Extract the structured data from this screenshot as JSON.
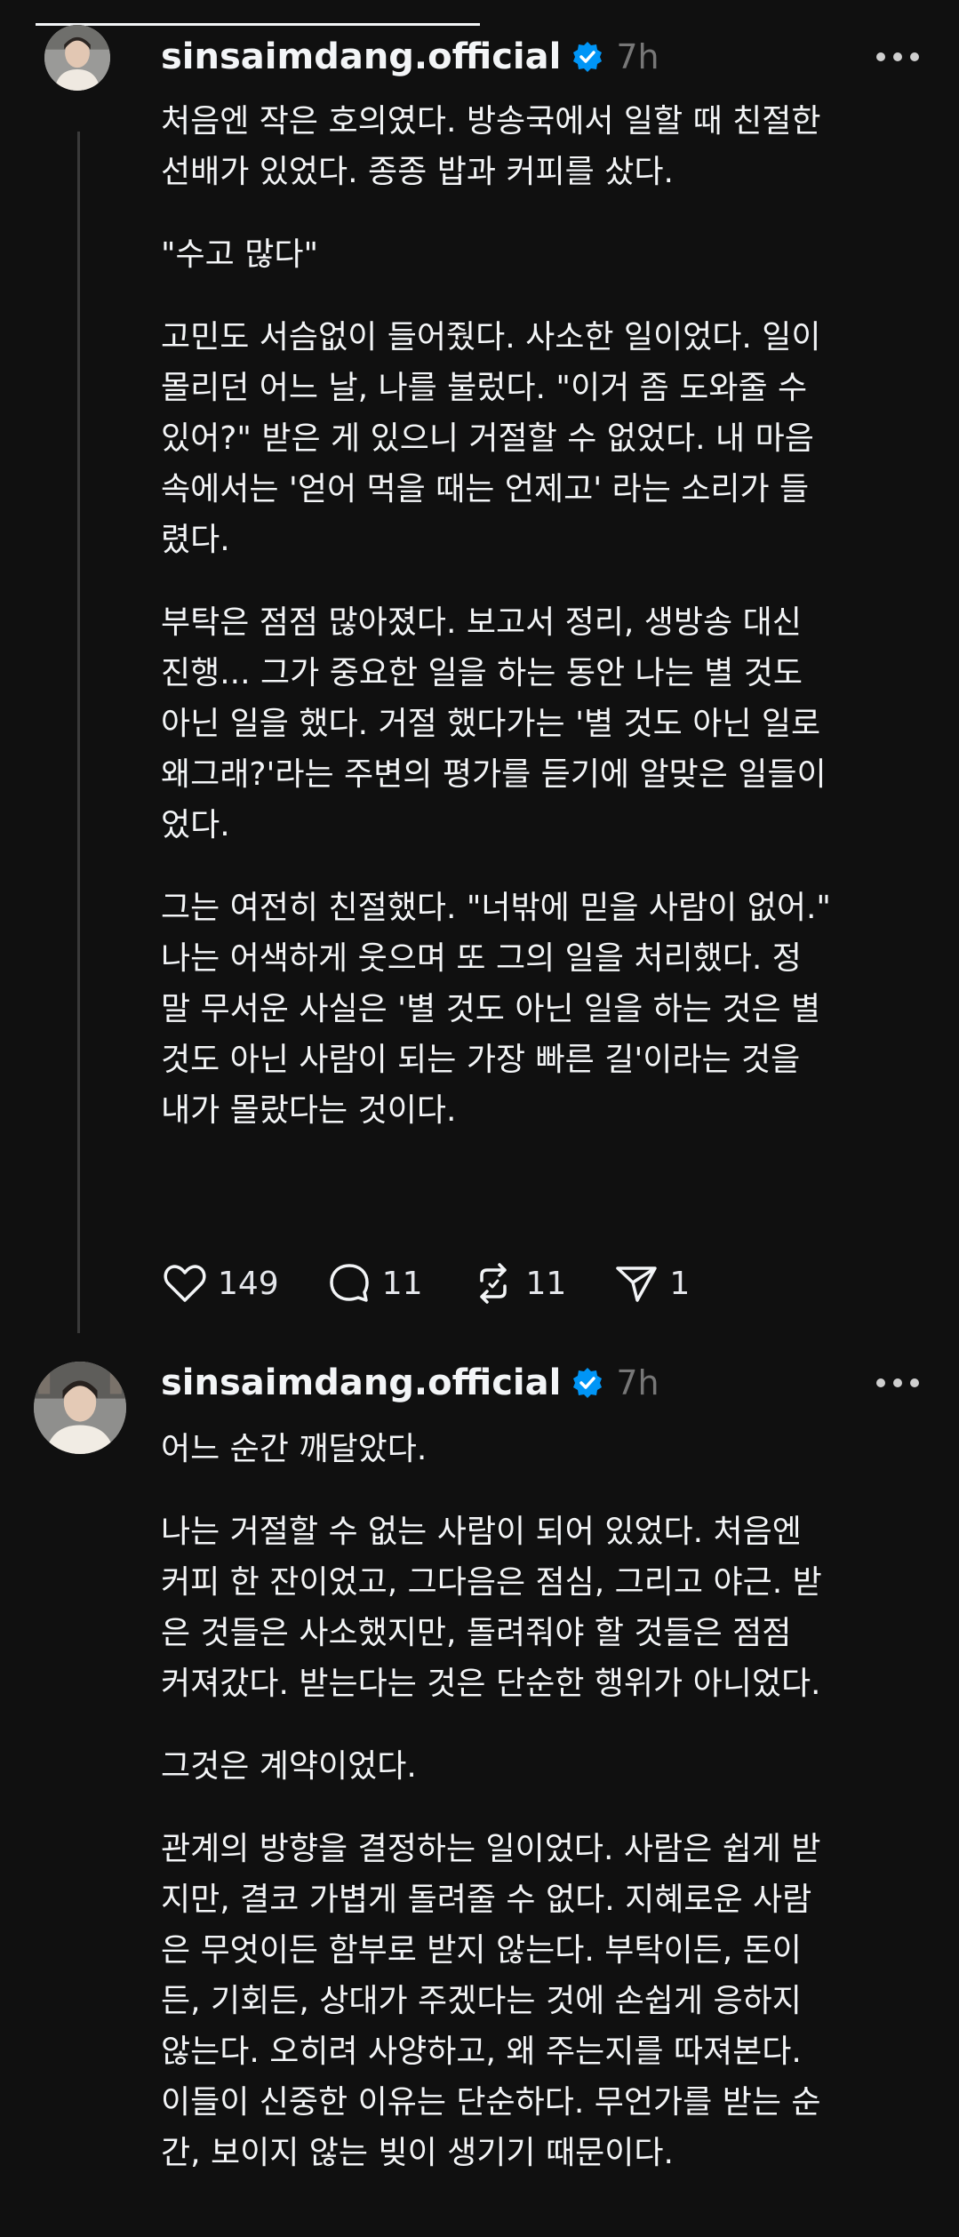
{
  "posts": [
    {
      "username": "sinsaimdang.official",
      "time": "7h",
      "paragraphs": [
        "처음엔 작은 호의였다. 방송국에서 일할 때 친절한\n선배가 있었다. 종종 밥과 커피를 샀다.",
        "\"수고 많다\"",
        "고민도 서슴없이 들어줬다. 사소한 일이었다. 일이\n몰리던 어느 날, 나를 불렀다. \"이거 좀 도와줄 수\n있어?\" 받은 게 있으니 거절할 수 없었다. 내 마음\n속에서는 '얻어 먹을 때는 언제고' 라는 소리가 들\n렸다.",
        "부탁은 점점 많아졌다. 보고서 정리, 생방송 대신\n진행... 그가 중요한 일을 하는 동안 나는 별 것도\n아닌 일을 했다. 거절 했다가는 '별 것도 아닌 일로\n왜그래?'라는 주변의 평가를 듣기에 알맞은 일들이\n었다.",
        "그는 여전히 친절했다. \"너밖에 믿을 사람이 없어.\"\n나는 어색하게 웃으며 또 그의 일을 처리했다. 정\n말 무서운 사실은 '별 것도 아닌 일을 하는 것은 별\n것도 아닌 사람이 되는 가장 빠른 길'이라는 것을\n내가 몰랐다는 것이다."
      ],
      "likes": "149",
      "comments": "11",
      "reposts": "11",
      "shares": "1"
    },
    {
      "username": "sinsaimdang.official",
      "time": "7h",
      "paragraphs": [
        "어느 순간 깨달았다.",
        "나는 거절할 수 없는 사람이 되어 있었다. 처음엔\n커피 한 잔이었고, 그다음은 점심, 그리고 야근. 받\n은 것들은 사소했지만, 돌려줘야 할 것들은 점점\n커져갔다. 받는다는 것은 단순한 행위가 아니었다.",
        "그것은 계약이었다.",
        "관계의 방향을 결정하는 일이었다. 사람은 쉽게 받\n지만, 결코 가볍게 돌려줄 수 없다. 지혜로운 사람\n은 무엇이든 함부로 받지 않는다. 부탁이든, 돈이\n든, 기회든, 상대가 주겠다는 것에 손쉽게 응하지\n않는다. 오히려 사양하고, 왜 주는지를 따져본다.\n이들이 신중한 이유는 단순하다. 무언가를 받는 순\n간, 보이지 않는 빚이 생기기 때문이다."
      ]
    }
  ],
  "icons": {
    "verified": "verified-badge-icon",
    "more": "more-options-icon",
    "like": "heart-icon",
    "comment": "comment-icon",
    "repost": "repost-icon",
    "share": "send-icon"
  },
  "colors": {
    "background": "#101010",
    "text": "#f3f5f7",
    "muted": "#777777",
    "verified": "#0095f6"
  }
}
